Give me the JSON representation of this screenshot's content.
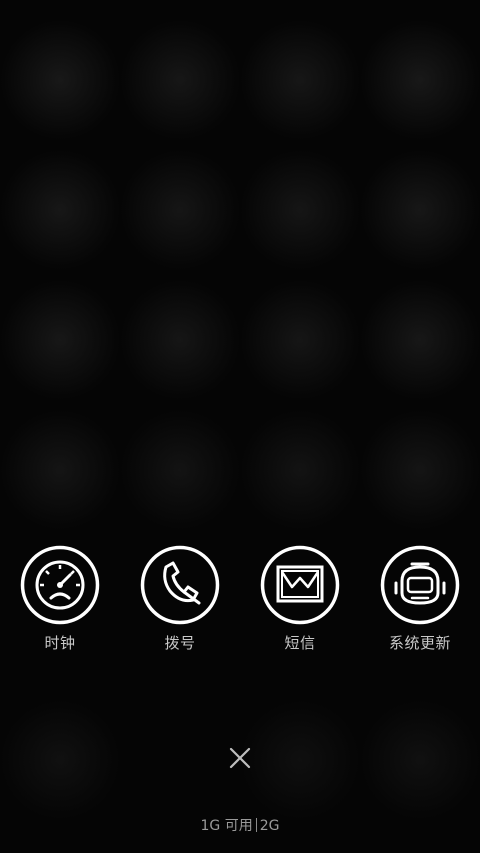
{
  "recent_apps": [
    {
      "label": "时钟",
      "icon": "speedometer-icon"
    },
    {
      "label": "拨号",
      "icon": "phone-icon"
    },
    {
      "label": "短信",
      "icon": "envelope-icon"
    },
    {
      "label": "系统更新",
      "icon": "robot-icon"
    }
  ],
  "close": {
    "icon": "close-icon"
  },
  "memory": {
    "available": "1G 可用",
    "total": "2G"
  },
  "colors": {
    "background": "#000000",
    "icon_stroke": "#ffffff",
    "label_text": "#c8c8c8"
  }
}
